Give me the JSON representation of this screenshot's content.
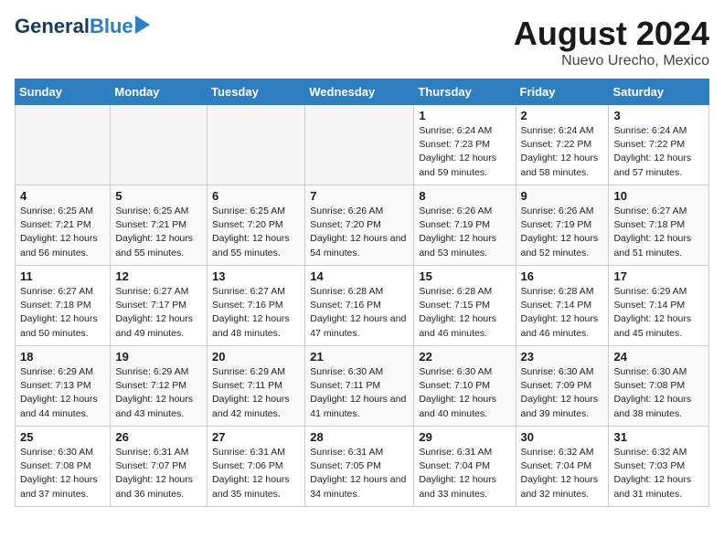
{
  "header": {
    "logo_general": "General",
    "logo_blue": "Blue",
    "main_title": "August 2024",
    "subtitle": "Nuevo Urecho, Mexico"
  },
  "weekdays": [
    "Sunday",
    "Monday",
    "Tuesday",
    "Wednesday",
    "Thursday",
    "Friday",
    "Saturday"
  ],
  "weeks": [
    [
      {
        "day": "",
        "empty": true
      },
      {
        "day": "",
        "empty": true
      },
      {
        "day": "",
        "empty": true
      },
      {
        "day": "",
        "empty": true
      },
      {
        "day": "1",
        "sunrise": "6:24 AM",
        "sunset": "7:23 PM",
        "daylight": "12 hours and 59 minutes."
      },
      {
        "day": "2",
        "sunrise": "6:24 AM",
        "sunset": "7:22 PM",
        "daylight": "12 hours and 58 minutes."
      },
      {
        "day": "3",
        "sunrise": "6:24 AM",
        "sunset": "7:22 PM",
        "daylight": "12 hours and 57 minutes."
      }
    ],
    [
      {
        "day": "4",
        "sunrise": "6:25 AM",
        "sunset": "7:21 PM",
        "daylight": "12 hours and 56 minutes."
      },
      {
        "day": "5",
        "sunrise": "6:25 AM",
        "sunset": "7:21 PM",
        "daylight": "12 hours and 55 minutes."
      },
      {
        "day": "6",
        "sunrise": "6:25 AM",
        "sunset": "7:20 PM",
        "daylight": "12 hours and 55 minutes."
      },
      {
        "day": "7",
        "sunrise": "6:26 AM",
        "sunset": "7:20 PM",
        "daylight": "12 hours and 54 minutes."
      },
      {
        "day": "8",
        "sunrise": "6:26 AM",
        "sunset": "7:19 PM",
        "daylight": "12 hours and 53 minutes."
      },
      {
        "day": "9",
        "sunrise": "6:26 AM",
        "sunset": "7:19 PM",
        "daylight": "12 hours and 52 minutes."
      },
      {
        "day": "10",
        "sunrise": "6:27 AM",
        "sunset": "7:18 PM",
        "daylight": "12 hours and 51 minutes."
      }
    ],
    [
      {
        "day": "11",
        "sunrise": "6:27 AM",
        "sunset": "7:18 PM",
        "daylight": "12 hours and 50 minutes."
      },
      {
        "day": "12",
        "sunrise": "6:27 AM",
        "sunset": "7:17 PM",
        "daylight": "12 hours and 49 minutes."
      },
      {
        "day": "13",
        "sunrise": "6:27 AM",
        "sunset": "7:16 PM",
        "daylight": "12 hours and 48 minutes."
      },
      {
        "day": "14",
        "sunrise": "6:28 AM",
        "sunset": "7:16 PM",
        "daylight": "12 hours and 47 minutes."
      },
      {
        "day": "15",
        "sunrise": "6:28 AM",
        "sunset": "7:15 PM",
        "daylight": "12 hours and 46 minutes."
      },
      {
        "day": "16",
        "sunrise": "6:28 AM",
        "sunset": "7:14 PM",
        "daylight": "12 hours and 46 minutes."
      },
      {
        "day": "17",
        "sunrise": "6:29 AM",
        "sunset": "7:14 PM",
        "daylight": "12 hours and 45 minutes."
      }
    ],
    [
      {
        "day": "18",
        "sunrise": "6:29 AM",
        "sunset": "7:13 PM",
        "daylight": "12 hours and 44 minutes."
      },
      {
        "day": "19",
        "sunrise": "6:29 AM",
        "sunset": "7:12 PM",
        "daylight": "12 hours and 43 minutes."
      },
      {
        "day": "20",
        "sunrise": "6:29 AM",
        "sunset": "7:11 PM",
        "daylight": "12 hours and 42 minutes."
      },
      {
        "day": "21",
        "sunrise": "6:30 AM",
        "sunset": "7:11 PM",
        "daylight": "12 hours and 41 minutes."
      },
      {
        "day": "22",
        "sunrise": "6:30 AM",
        "sunset": "7:10 PM",
        "daylight": "12 hours and 40 minutes."
      },
      {
        "day": "23",
        "sunrise": "6:30 AM",
        "sunset": "7:09 PM",
        "daylight": "12 hours and 39 minutes."
      },
      {
        "day": "24",
        "sunrise": "6:30 AM",
        "sunset": "7:08 PM",
        "daylight": "12 hours and 38 minutes."
      }
    ],
    [
      {
        "day": "25",
        "sunrise": "6:30 AM",
        "sunset": "7:08 PM",
        "daylight": "12 hours and 37 minutes."
      },
      {
        "day": "26",
        "sunrise": "6:31 AM",
        "sunset": "7:07 PM",
        "daylight": "12 hours and 36 minutes."
      },
      {
        "day": "27",
        "sunrise": "6:31 AM",
        "sunset": "7:06 PM",
        "daylight": "12 hours and 35 minutes."
      },
      {
        "day": "28",
        "sunrise": "6:31 AM",
        "sunset": "7:05 PM",
        "daylight": "12 hours and 34 minutes."
      },
      {
        "day": "29",
        "sunrise": "6:31 AM",
        "sunset": "7:04 PM",
        "daylight": "12 hours and 33 minutes."
      },
      {
        "day": "30",
        "sunrise": "6:32 AM",
        "sunset": "7:04 PM",
        "daylight": "12 hours and 32 minutes."
      },
      {
        "day": "31",
        "sunrise": "6:32 AM",
        "sunset": "7:03 PM",
        "daylight": "12 hours and 31 minutes."
      }
    ]
  ],
  "labels": {
    "sunrise": "Sunrise:",
    "sunset": "Sunset:",
    "daylight": "Daylight:"
  }
}
